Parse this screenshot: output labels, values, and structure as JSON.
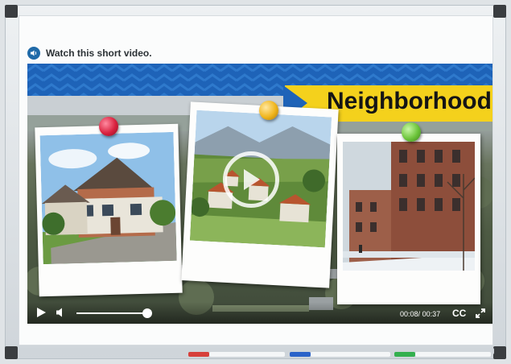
{
  "instruction": {
    "text": "Watch this short video."
  },
  "video": {
    "title": "Neighborhood",
    "current_time": "00:08",
    "separator": "/",
    "duration": "00:37",
    "cc_label": "CC",
    "progress_fraction": 0.22
  },
  "pins": {
    "left": "#d9213e",
    "center": "#f0b51c",
    "right": "#6cc43a"
  },
  "markers": [
    {
      "cap": "#d7403b"
    },
    {
      "cap": "#2a63c9"
    },
    {
      "cap": "#34b04f"
    }
  ],
  "icons": [
    "volume-icon",
    "play-icon",
    "mute-icon",
    "cc-icon",
    "fullscreen-icon",
    "play-overlay-icon"
  ]
}
